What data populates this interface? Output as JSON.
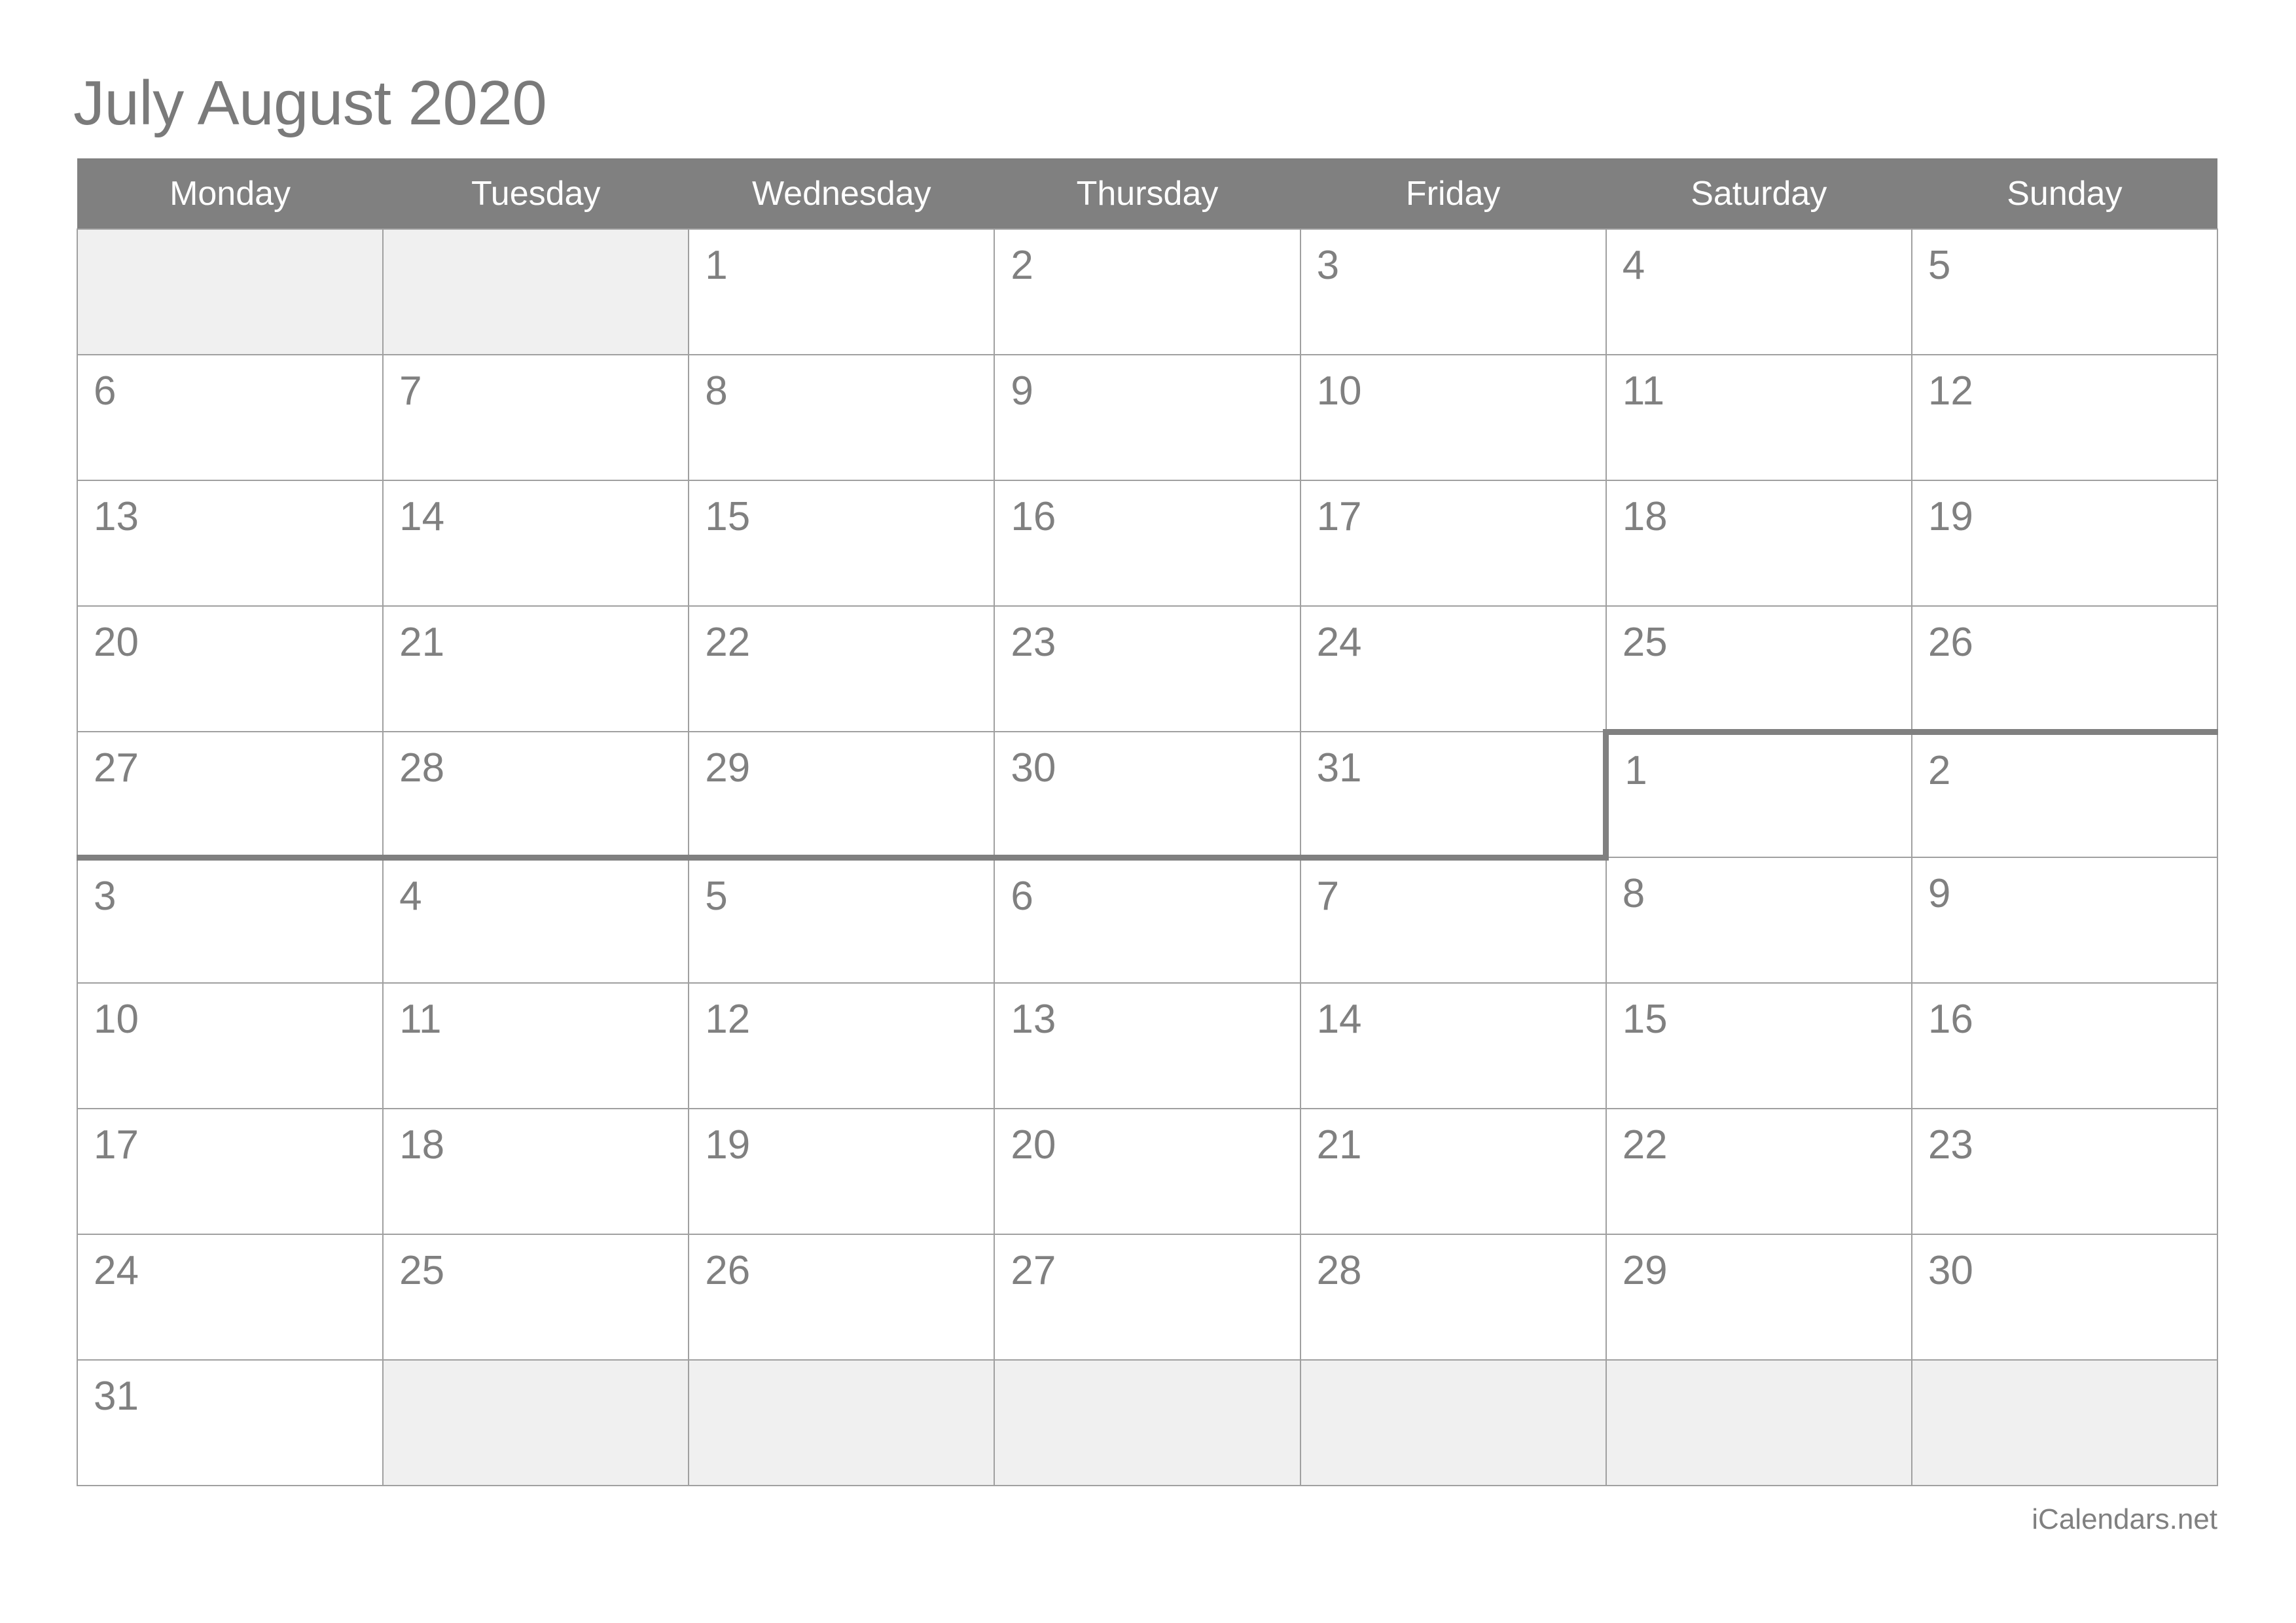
{
  "title": "July August 2020",
  "credit": "iCalendars.net",
  "colors": {
    "header_bg": "#808080",
    "header_text": "#ffffff",
    "date_text": "#808080",
    "blank_cell_bg": "#f0f0f0",
    "grid_line": "#a0a0a0",
    "month_boundary": "#808080",
    "page_bg": "#ffffff"
  },
  "weekday_headers": [
    "Monday",
    "Tuesday",
    "Wednesday",
    "Thursday",
    "Friday",
    "Saturday",
    "Sunday"
  ],
  "weeks": [
    {
      "cells": [
        {
          "label": "",
          "blank": true,
          "edges": []
        },
        {
          "label": "",
          "blank": true,
          "edges": []
        },
        {
          "label": "1",
          "blank": false,
          "edges": []
        },
        {
          "label": "2",
          "blank": false,
          "edges": []
        },
        {
          "label": "3",
          "blank": false,
          "edges": []
        },
        {
          "label": "4",
          "blank": false,
          "edges": []
        },
        {
          "label": "5",
          "blank": false,
          "edges": []
        }
      ]
    },
    {
      "cells": [
        {
          "label": "6",
          "blank": false,
          "edges": []
        },
        {
          "label": "7",
          "blank": false,
          "edges": []
        },
        {
          "label": "8",
          "blank": false,
          "edges": []
        },
        {
          "label": "9",
          "blank": false,
          "edges": []
        },
        {
          "label": "10",
          "blank": false,
          "edges": []
        },
        {
          "label": "11",
          "blank": false,
          "edges": []
        },
        {
          "label": "12",
          "blank": false,
          "edges": []
        }
      ]
    },
    {
      "cells": [
        {
          "label": "13",
          "blank": false,
          "edges": []
        },
        {
          "label": "14",
          "blank": false,
          "edges": []
        },
        {
          "label": "15",
          "blank": false,
          "edges": []
        },
        {
          "label": "16",
          "blank": false,
          "edges": []
        },
        {
          "label": "17",
          "blank": false,
          "edges": []
        },
        {
          "label": "18",
          "blank": false,
          "edges": []
        },
        {
          "label": "19",
          "blank": false,
          "edges": []
        }
      ]
    },
    {
      "cells": [
        {
          "label": "20",
          "blank": false,
          "edges": []
        },
        {
          "label": "21",
          "blank": false,
          "edges": []
        },
        {
          "label": "22",
          "blank": false,
          "edges": []
        },
        {
          "label": "23",
          "blank": false,
          "edges": []
        },
        {
          "label": "24",
          "blank": false,
          "edges": []
        },
        {
          "label": "25",
          "blank": false,
          "edges": [
            "mb-bottom"
          ]
        },
        {
          "label": "26",
          "blank": false,
          "edges": [
            "mb-bottom"
          ]
        }
      ]
    },
    {
      "cells": [
        {
          "label": "27",
          "blank": false,
          "edges": [
            "mb-bottom"
          ]
        },
        {
          "label": "28",
          "blank": false,
          "edges": [
            "mb-bottom"
          ]
        },
        {
          "label": "29",
          "blank": false,
          "edges": [
            "mb-bottom"
          ]
        },
        {
          "label": "30",
          "blank": false,
          "edges": [
            "mb-bottom"
          ]
        },
        {
          "label": "31",
          "blank": false,
          "edges": [
            "mb-bottom"
          ]
        },
        {
          "label": "1",
          "blank": false,
          "edges": [
            "mb-top",
            "mb-left"
          ]
        },
        {
          "label": "2",
          "blank": false,
          "edges": [
            "mb-top"
          ]
        }
      ]
    },
    {
      "cells": [
        {
          "label": "3",
          "blank": false,
          "edges": []
        },
        {
          "label": "4",
          "blank": false,
          "edges": []
        },
        {
          "label": "5",
          "blank": false,
          "edges": []
        },
        {
          "label": "6",
          "blank": false,
          "edges": []
        },
        {
          "label": "7",
          "blank": false,
          "edges": []
        },
        {
          "label": "8",
          "blank": false,
          "edges": []
        },
        {
          "label": "9",
          "blank": false,
          "edges": []
        }
      ]
    },
    {
      "cells": [
        {
          "label": "10",
          "blank": false,
          "edges": []
        },
        {
          "label": "11",
          "blank": false,
          "edges": []
        },
        {
          "label": "12",
          "blank": false,
          "edges": []
        },
        {
          "label": "13",
          "blank": false,
          "edges": []
        },
        {
          "label": "14",
          "blank": false,
          "edges": []
        },
        {
          "label": "15",
          "blank": false,
          "edges": []
        },
        {
          "label": "16",
          "blank": false,
          "edges": []
        }
      ]
    },
    {
      "cells": [
        {
          "label": "17",
          "blank": false,
          "edges": []
        },
        {
          "label": "18",
          "blank": false,
          "edges": []
        },
        {
          "label": "19",
          "blank": false,
          "edges": []
        },
        {
          "label": "20",
          "blank": false,
          "edges": []
        },
        {
          "label": "21",
          "blank": false,
          "edges": []
        },
        {
          "label": "22",
          "blank": false,
          "edges": []
        },
        {
          "label": "23",
          "blank": false,
          "edges": []
        }
      ]
    },
    {
      "cells": [
        {
          "label": "24",
          "blank": false,
          "edges": []
        },
        {
          "label": "25",
          "blank": false,
          "edges": []
        },
        {
          "label": "26",
          "blank": false,
          "edges": []
        },
        {
          "label": "27",
          "blank": false,
          "edges": []
        },
        {
          "label": "28",
          "blank": false,
          "edges": []
        },
        {
          "label": "29",
          "blank": false,
          "edges": []
        },
        {
          "label": "30",
          "blank": false,
          "edges": []
        }
      ]
    },
    {
      "cells": [
        {
          "label": "31",
          "blank": false,
          "edges": []
        },
        {
          "label": "",
          "blank": true,
          "edges": []
        },
        {
          "label": "",
          "blank": true,
          "edges": []
        },
        {
          "label": "",
          "blank": true,
          "edges": []
        },
        {
          "label": "",
          "blank": true,
          "edges": []
        },
        {
          "label": "",
          "blank": true,
          "edges": []
        },
        {
          "label": "",
          "blank": true,
          "edges": []
        }
      ]
    }
  ]
}
